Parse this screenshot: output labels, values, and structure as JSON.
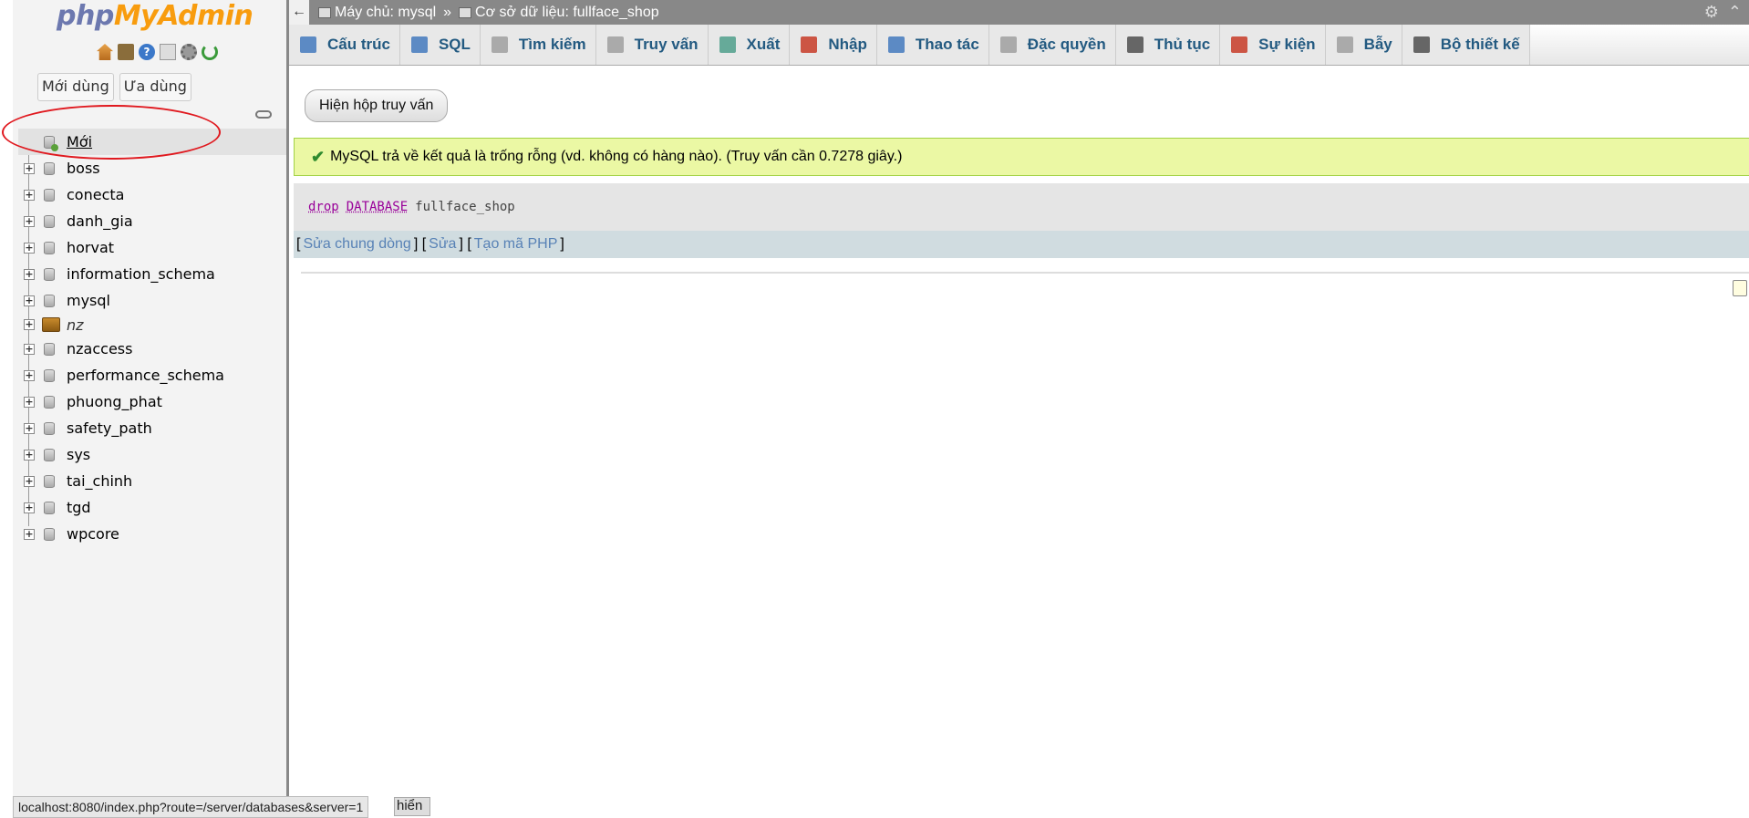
{
  "logo": {
    "php": "php",
    "my": "MyAdmin"
  },
  "left_panel": {
    "tabs": [
      "Mới dùng",
      "Ưa dùng"
    ],
    "new_label": "Mới",
    "databases": [
      "boss",
      "conecta",
      "danh_gia",
      "horvat",
      "information_schema",
      "mysql",
      "nz",
      "nzaccess",
      "performance_schema",
      "phuong_phat",
      "safety_path",
      "sys",
      "tai_chinh",
      "tgd",
      "wpcore"
    ]
  },
  "breadcrumb": {
    "server": "Máy chủ: mysql",
    "separator": "»",
    "database": "Cơ sở dữ liệu: fullface_shop"
  },
  "menu": [
    {
      "label": "Cấu trúc",
      "icon": "structure-icon"
    },
    {
      "label": "SQL",
      "icon": "sql-icon"
    },
    {
      "label": "Tìm kiếm",
      "icon": "search-icon"
    },
    {
      "label": "Truy vấn",
      "icon": "query-icon"
    },
    {
      "label": "Xuất",
      "icon": "export-icon"
    },
    {
      "label": "Nhập",
      "icon": "import-icon"
    },
    {
      "label": "Thao tác",
      "icon": "wrench-icon"
    },
    {
      "label": "Đặc quyền",
      "icon": "privileges-icon"
    },
    {
      "label": "Thủ tục",
      "icon": "routines-icon"
    },
    {
      "label": "Sự kiện",
      "icon": "events-icon"
    },
    {
      "label": "Bẫy",
      "icon": "triggers-icon"
    },
    {
      "label": "Bộ thiết kế",
      "icon": "designer-icon"
    }
  ],
  "main": {
    "show_query_button": "Hiện hộp truy vấn",
    "success_message": "MySQL trả về kết quả là trống rỗng (vd. không có hàng nào). (Truy vấn cần 0.7278 giây.)",
    "sql": {
      "kw1": "drop",
      "kw2": "DATABASE",
      "name": "fullface_shop"
    },
    "links": {
      "inline": "Sửa chung dòng",
      "edit": "Sửa",
      "php": "Tạo mã PHP"
    }
  },
  "status_bar": "localhost:8080/index.php?route=/server/databases&server=1",
  "console_tab": "hiển",
  "colors": {
    "accent_link": "#235a81",
    "success_bg": "#ebf8a4",
    "annotation": "#e0191f"
  }
}
